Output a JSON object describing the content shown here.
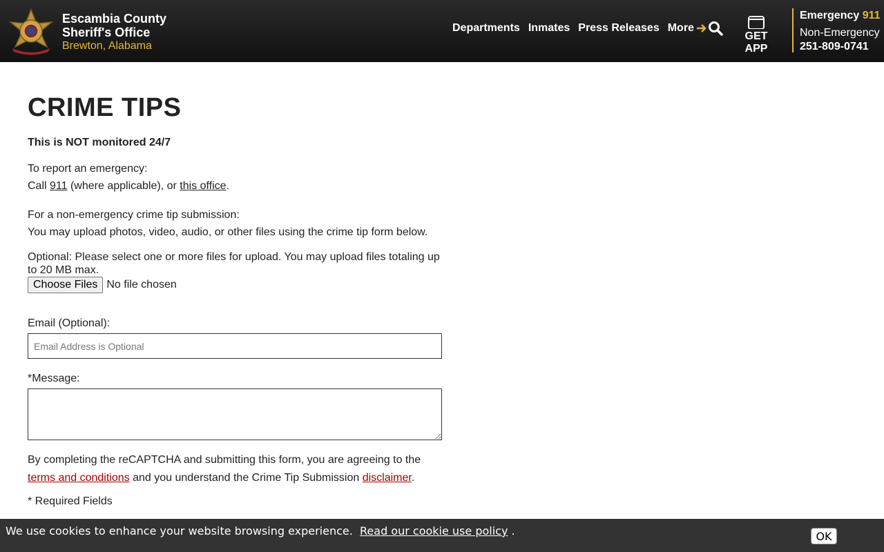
{
  "header": {
    "brand_line1": "Escambia County",
    "brand_line2": "Sheriff's Office",
    "brand_location": "Brewton, Alabama",
    "nav": [
      "Departments",
      "Inmates",
      "Press Releases",
      "More"
    ],
    "get_app": "GET APP",
    "emergency_label": "Emergency",
    "emergency_number": "911",
    "non_emergency_label": "Non-Emergency",
    "non_emergency_number": "251-809-0741",
    "accent_color": "#e8b53c"
  },
  "page": {
    "title": "CRIME TIPS",
    "notice": "This is NOT monitored 24/7",
    "emergency_intro": "To report an emergency:",
    "call_prefix": "Call ",
    "call_number": "911",
    "call_middle": " (where applicable), or ",
    "call_link": "this office",
    "call_suffix": ".",
    "tip_intro": "For a non-emergency crime tip submission:",
    "tip_detail": "You may upload photos, video, audio, or other files using the crime tip form below.",
    "upload_note": "Optional: Please select one or more files for upload. You may upload files totaling up to 20 MB max.",
    "choose_files": "Choose Files",
    "no_file": "No file chosen",
    "email_label": "Email (Optional):",
    "email_placeholder": "Email Address is Optional",
    "message_label": "*Message:",
    "agree_prefix": "By completing the reCAPTCHA and submitting this form, you are agreeing to the ",
    "terms_link": "terms and conditions",
    "agree_middle": " and you understand the Crime Tip Submission ",
    "disclaimer_link": "disclaimer",
    "agree_suffix": ".",
    "required": "* Required Fields"
  },
  "cookie": {
    "text": "We use cookies to enhance your website browsing experience.",
    "link": "Read our cookie use policy",
    "suffix": ".",
    "ok": "OK"
  }
}
